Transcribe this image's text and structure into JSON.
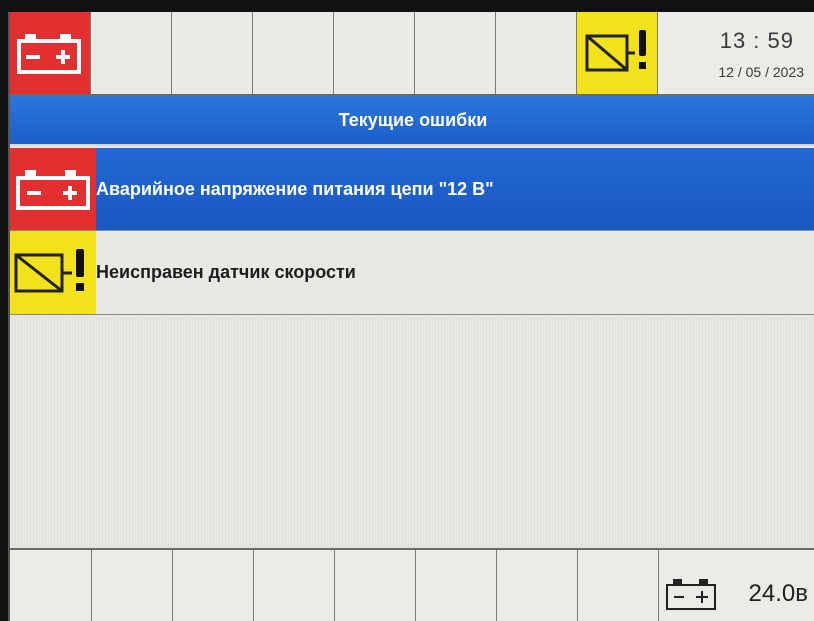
{
  "status_bar": {
    "time": "13 : 59",
    "date": "12 / 05 / 2023",
    "icons": [
      "battery-icon",
      "sensor-fault-icon"
    ]
  },
  "title": "Текущие ошибки",
  "errors": [
    {
      "icon": "battery-icon",
      "text": "Аварийное напряжение питания цепи \"12 В\"",
      "selected": true
    },
    {
      "icon": "sensor-fault-icon",
      "text": "Неисправен датчик скорости",
      "selected": false
    }
  ],
  "footer": {
    "voltage": "24.0в",
    "icon": "battery-icon"
  },
  "colors": {
    "selected_row": "#1f62cc",
    "battery_alarm": "#e23030",
    "sensor_alarm": "#f2e21b"
  }
}
